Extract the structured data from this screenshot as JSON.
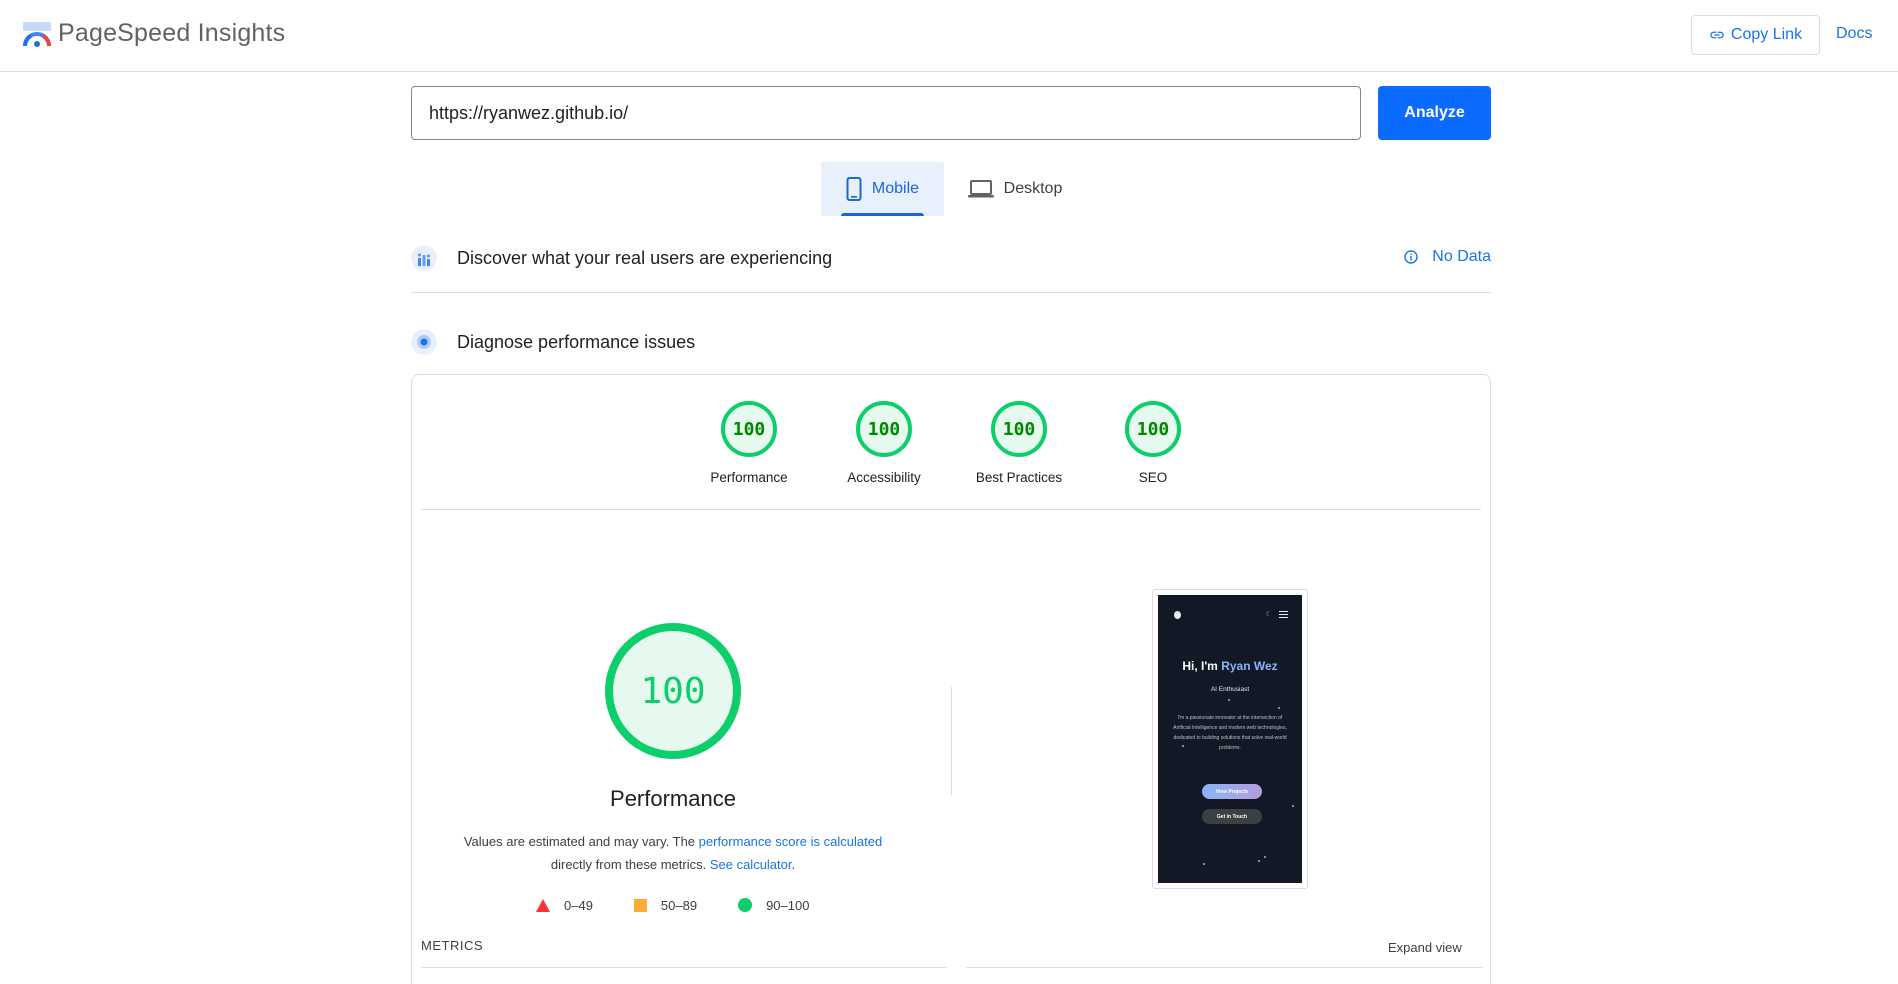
{
  "header": {
    "title": "PageSpeed Insights",
    "copy_link_label": "Copy Link",
    "docs_label": "Docs"
  },
  "search": {
    "url": "https://ryanwez.github.io/",
    "analyze_label": "Analyze"
  },
  "tabs": [
    {
      "label": "Mobile",
      "icon": "smartphone-icon",
      "selected": true
    },
    {
      "label": "Desktop",
      "icon": "laptop-icon",
      "selected": false
    }
  ],
  "field_data": {
    "title": "Discover what your real users are experiencing",
    "status": "No Data"
  },
  "lab_data": {
    "title": "Diagnose performance issues"
  },
  "categories": [
    {
      "label": "Performance",
      "score": "100"
    },
    {
      "label": "Accessibility",
      "score": "100"
    },
    {
      "label": "Best Practices",
      "score": "100"
    },
    {
      "label": "SEO",
      "score": "100"
    }
  ],
  "performance": {
    "score": "100",
    "label": "Performance",
    "note_prefix": "Values are estimated and may vary. The ",
    "note_link1": "performance score is calculated",
    "note_mid": "directly from these metrics.",
    "note_link2": "See calculator",
    "note_suffix": "."
  },
  "legend": [
    {
      "range": "0–49",
      "shape": "triangle",
      "color": "#ff3333"
    },
    {
      "range": "50–89",
      "shape": "square",
      "color": "#ffaa33"
    },
    {
      "range": "90–100",
      "shape": "circle",
      "color": "#0cce6b"
    }
  ],
  "preview": {
    "greeting": "Hi, I'm ",
    "name": "Ryan Wez",
    "subtitle": "AI Enthusiast",
    "paragraph": "I'm a passionate innovator at the intersection of Artificial Intelligence and modern web technologies, dedicated to building solutions that solve real-world problems.",
    "btn_primary": "View Projects",
    "btn_secondary": "Get in Touch"
  },
  "metrics": {
    "heading": "METRICS",
    "expand_label": "Expand view"
  },
  "colors": {
    "accent": "#1a73e8",
    "analyze_button": "#0b6bff",
    "pass": "#0cce6b"
  }
}
